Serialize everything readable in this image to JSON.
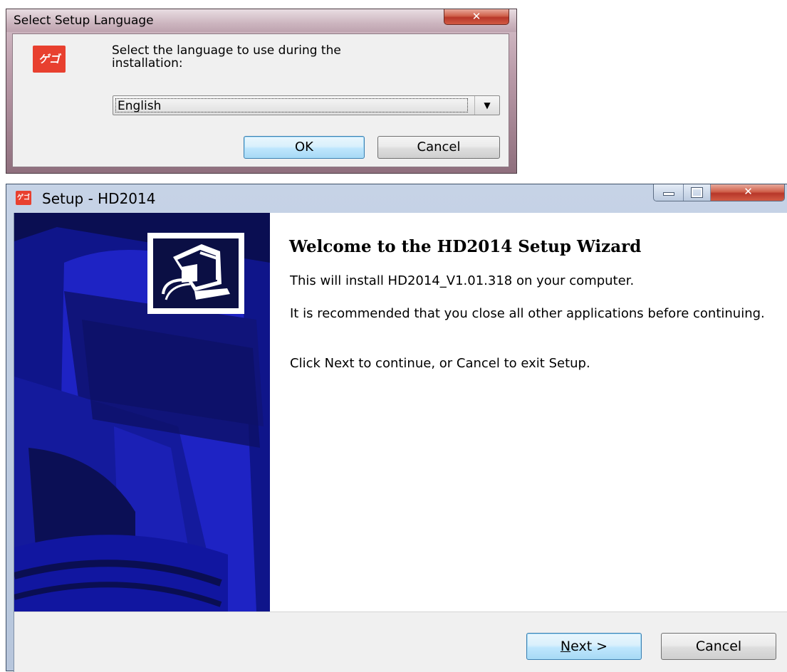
{
  "language_dialog": {
    "title": "Select Setup Language",
    "close_glyph": "✕",
    "logo_text": "ゲゴ",
    "prompt": "Select the language to use during the\ninstallation:",
    "language_select": {
      "selected": "English",
      "arrow": "▼"
    },
    "ok_label": "OK",
    "cancel_label": "Cancel"
  },
  "wizard": {
    "title": "Setup - HD2014",
    "icon_text": "ゲゴ",
    "close_glyph": "✕",
    "welcome_title": "Welcome to the HD2014 Setup Wizard",
    "paragraphs": [
      "This will install HD2014_V1.01.318 on your computer.",
      "It is recommended that you close all other applications before continuing.",
      "Click Next to continue, or Cancel to exit Setup."
    ],
    "next_label_mnemonic": "N",
    "next_label_rest": "ext >",
    "cancel_label": "Cancel"
  },
  "colors": {
    "sidebar_background": "#0a0e52",
    "logo_red": "#e8402f",
    "default_button_border": "#3c7fb1"
  }
}
